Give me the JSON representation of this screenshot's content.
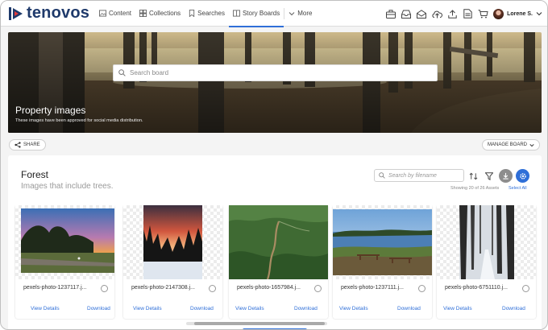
{
  "app": {
    "name": "tenovos",
    "brand_color": "#1f3a6b",
    "accent": "#2f6fd8"
  },
  "nav": {
    "items": [
      {
        "label": "Content",
        "icon": "image-icon"
      },
      {
        "label": "Collections",
        "icon": "grid-icon"
      },
      {
        "label": "Searches",
        "icon": "bookmark-icon"
      },
      {
        "label": "Story Boards",
        "icon": "storyboard-icon",
        "active": true
      },
      {
        "label": "More",
        "icon": "chevron-down-icon"
      }
    ]
  },
  "toolbar_icons": [
    "briefcase-icon",
    "inbox-icon",
    "mail-open-icon",
    "upload-cloud-icon",
    "upload-icon",
    "report-icon",
    "cart-icon"
  ],
  "user": {
    "name": "Lorene S."
  },
  "hero": {
    "search_placeholder": "Search board",
    "title": "Property images",
    "subtitle": "These images have been approved for social media distribution."
  },
  "actions": {
    "share": "SHARE",
    "manage": "MANAGE BOARD"
  },
  "section": {
    "title": "Forest",
    "subtitle": "Images that include trees.",
    "filter_placeholder": "Search by filename",
    "count_text": "Showing 20 of 26 Assets",
    "select_all": "Select All"
  },
  "cards": [
    {
      "filename": "pexels-photo-1237117.j...",
      "view": "View Details",
      "download": "Download"
    },
    {
      "filename": "pexels-photo-2147308.j...",
      "view": "View Details",
      "download": "Download"
    },
    {
      "filename": "pexels-photo-1657984.j...",
      "view": "View Details",
      "download": "Download"
    },
    {
      "filename": "pexels-photo-1237111.j...",
      "view": "View Details",
      "download": "Download"
    },
    {
      "filename": "pexels-photo-6751110.j...",
      "view": "View Details",
      "download": "Download"
    }
  ]
}
